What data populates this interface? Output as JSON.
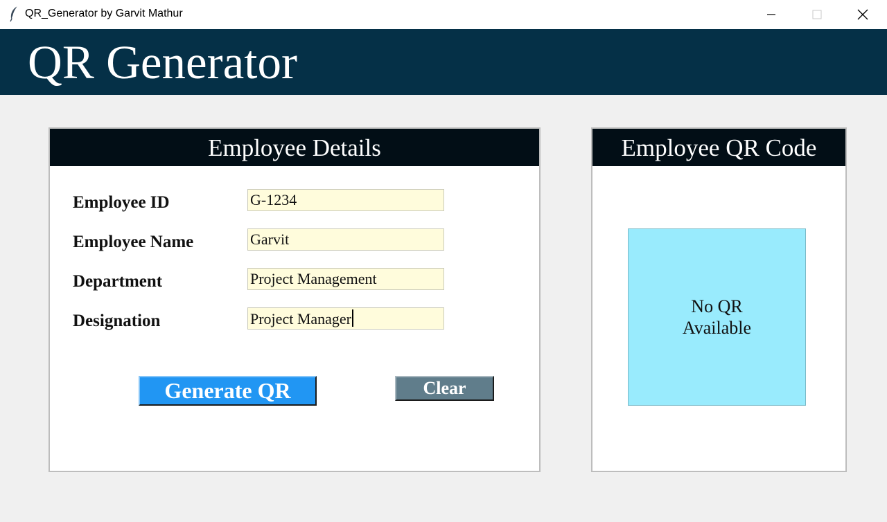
{
  "window": {
    "title": "QR_Generator by Garvit Mathur",
    "icon": "feather-icon"
  },
  "header": {
    "title": "QR Generator"
  },
  "details_panel": {
    "title": "Employee Details",
    "fields": [
      {
        "label": "Employee ID",
        "value": "G-1234"
      },
      {
        "label": "Employee Name",
        "value": "Garvit"
      },
      {
        "label": "Department",
        "value": "Project Management"
      },
      {
        "label": "Designation",
        "value": "Project Manager"
      }
    ],
    "generate_label": "Generate QR",
    "clear_label": "Clear"
  },
  "qr_panel": {
    "title": "Employee QR Code",
    "placeholder": "No QR Available"
  },
  "colors": {
    "header_bg": "#053047",
    "panel_title_bg": "#020e16",
    "input_bg": "#fffcdc",
    "generate_bg": "#2196f3",
    "clear_bg": "#607d8b",
    "qr_box_bg": "#99ebfd"
  }
}
